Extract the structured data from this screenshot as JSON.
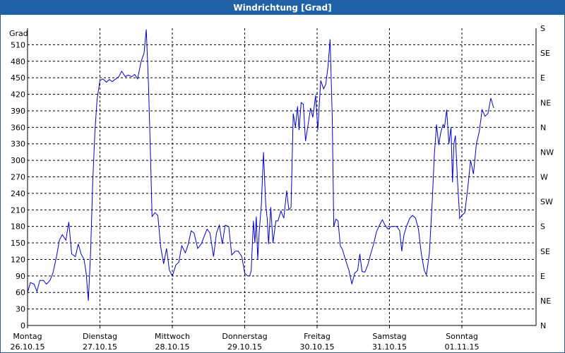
{
  "chart_data": {
    "type": "line",
    "title": "Windrichtung [Grad]",
    "ylabel": "Grad",
    "ylim": [
      0,
      540
    ],
    "yticks": [
      0,
      30,
      60,
      90,
      120,
      150,
      180,
      210,
      240,
      270,
      300,
      330,
      360,
      390,
      420,
      450,
      480,
      510
    ],
    "right_axis_labels": [
      "N",
      "NE",
      "E",
      "SE",
      "S",
      "SW",
      "W",
      "NW",
      "N",
      "NE",
      "E",
      "SE",
      "S"
    ],
    "x_ticks": [
      {
        "day": "Montag",
        "date": "26.10.15"
      },
      {
        "day": "Dienstag",
        "date": "27.10.15"
      },
      {
        "day": "Mittwoch",
        "date": "28.10.15"
      },
      {
        "day": "Donnerstag",
        "date": "29.10.15"
      },
      {
        "day": "Freitag",
        "date": "30.10.15"
      },
      {
        "day": "Samstag",
        "date": "31.10.15"
      },
      {
        "day": "Sonntag",
        "date": "01.11.15"
      }
    ],
    "grid": true,
    "series": [
      {
        "color": "#0000cc",
        "points": [
          [
            0.0,
            60
          ],
          [
            0.04,
            78
          ],
          [
            0.09,
            75
          ],
          [
            0.13,
            62
          ],
          [
            0.17,
            82
          ],
          [
            0.22,
            82
          ],
          [
            0.26,
            75
          ],
          [
            0.31,
            82
          ],
          [
            0.35,
            95
          ],
          [
            0.4,
            125
          ],
          [
            0.44,
            155
          ],
          [
            0.48,
            165
          ],
          [
            0.53,
            155
          ],
          [
            0.57,
            188
          ],
          [
            0.61,
            130
          ],
          [
            0.66,
            125
          ],
          [
            0.7,
            148
          ],
          [
            0.74,
            130
          ],
          [
            0.78,
            120
          ],
          [
            0.81,
            95
          ],
          [
            0.84,
            45
          ],
          [
            0.87,
            130
          ],
          [
            0.9,
            260
          ],
          [
            0.93,
            350
          ],
          [
            0.96,
            410
          ],
          [
            1.0,
            445
          ],
          [
            1.04,
            448
          ],
          [
            1.09,
            442
          ],
          [
            1.13,
            447
          ],
          [
            1.17,
            443
          ],
          [
            1.22,
            448
          ],
          [
            1.26,
            452
          ],
          [
            1.3,
            462
          ],
          [
            1.35,
            452
          ],
          [
            1.39,
            455
          ],
          [
            1.44,
            452
          ],
          [
            1.48,
            456
          ],
          [
            1.52,
            448
          ],
          [
            1.57,
            480
          ],
          [
            1.61,
            495
          ],
          [
            1.64,
            538
          ],
          [
            1.67,
            440
          ],
          [
            1.7,
            300
          ],
          [
            1.72,
            198
          ],
          [
            1.76,
            205
          ],
          [
            1.8,
            200
          ],
          [
            1.84,
            142
          ],
          [
            1.88,
            112
          ],
          [
            1.92,
            140
          ],
          [
            1.96,
            100
          ],
          [
            2.0,
            90
          ],
          [
            2.05,
            110
          ],
          [
            2.09,
            115
          ],
          [
            2.13,
            145
          ],
          [
            2.18,
            132
          ],
          [
            2.22,
            148
          ],
          [
            2.26,
            172
          ],
          [
            2.3,
            168
          ],
          [
            2.35,
            140
          ],
          [
            2.4,
            148
          ],
          [
            2.44,
            162
          ],
          [
            2.48,
            175
          ],
          [
            2.52,
            168
          ],
          [
            2.57,
            125
          ],
          [
            2.61,
            168
          ],
          [
            2.65,
            182
          ],
          [
            2.69,
            148
          ],
          [
            2.73,
            182
          ],
          [
            2.78,
            180
          ],
          [
            2.82,
            128
          ],
          [
            2.87,
            135
          ],
          [
            2.91,
            135
          ],
          [
            2.96,
            125
          ],
          [
            3.0,
            95
          ],
          [
            3.04,
            90
          ],
          [
            3.07,
            90
          ],
          [
            3.09,
            100
          ],
          [
            3.12,
            190
          ],
          [
            3.14,
            150
          ],
          [
            3.16,
            198
          ],
          [
            3.18,
            120
          ],
          [
            3.2,
            170
          ],
          [
            3.23,
            220
          ],
          [
            3.26,
            315
          ],
          [
            3.29,
            220
          ],
          [
            3.31,
            195
          ],
          [
            3.33,
            148
          ],
          [
            3.36,
            215
          ],
          [
            3.39,
            150
          ],
          [
            3.43,
            190
          ],
          [
            3.46,
            190
          ],
          [
            3.5,
            208
          ],
          [
            3.54,
            195
          ],
          [
            3.58,
            245
          ],
          [
            3.61,
            210
          ],
          [
            3.64,
            215
          ],
          [
            3.67,
            385
          ],
          [
            3.7,
            360
          ],
          [
            3.73,
            398
          ],
          [
            3.75,
            355
          ],
          [
            3.78,
            405
          ],
          [
            3.81,
            402
          ],
          [
            3.84,
            335
          ],
          [
            3.87,
            360
          ],
          [
            3.91,
            395
          ],
          [
            3.94,
            378
          ],
          [
            3.98,
            418
          ],
          [
            4.01,
            355
          ],
          [
            4.05,
            445
          ],
          [
            4.09,
            430
          ],
          [
            4.12,
            438
          ],
          [
            4.15,
            470
          ],
          [
            4.18,
            520
          ],
          [
            4.21,
            375
          ],
          [
            4.23,
            180
          ],
          [
            4.26,
            193
          ],
          [
            4.29,
            190
          ],
          [
            4.32,
            145
          ],
          [
            4.35,
            138
          ],
          [
            4.39,
            120
          ],
          [
            4.44,
            100
          ],
          [
            4.48,
            75
          ],
          [
            4.52,
            95
          ],
          [
            4.56,
            100
          ],
          [
            4.59,
            130
          ],
          [
            4.62,
            98
          ],
          [
            4.66,
            97
          ],
          [
            4.7,
            110
          ],
          [
            4.74,
            130
          ],
          [
            4.78,
            148
          ],
          [
            4.82,
            170
          ],
          [
            4.86,
            182
          ],
          [
            4.9,
            192
          ],
          [
            4.94,
            182
          ],
          [
            4.98,
            175
          ],
          [
            5.02,
            180
          ],
          [
            5.06,
            180
          ],
          [
            5.1,
            180
          ],
          [
            5.14,
            172
          ],
          [
            5.17,
            135
          ],
          [
            5.2,
            165
          ],
          [
            5.24,
            182
          ],
          [
            5.28,
            195
          ],
          [
            5.32,
            200
          ],
          [
            5.36,
            195
          ],
          [
            5.4,
            175
          ],
          [
            5.44,
            130
          ],
          [
            5.48,
            100
          ],
          [
            5.51,
            92
          ],
          [
            5.55,
            130
          ],
          [
            5.59,
            225
          ],
          [
            5.62,
            310
          ],
          [
            5.65,
            365
          ],
          [
            5.68,
            328
          ],
          [
            5.71,
            352
          ],
          [
            5.74,
            365
          ],
          [
            5.76,
            360
          ],
          [
            5.79,
            392
          ],
          [
            5.82,
            330
          ],
          [
            5.85,
            360
          ],
          [
            5.87,
            260
          ],
          [
            5.89,
            330
          ],
          [
            5.91,
            345
          ],
          [
            5.94,
            260
          ],
          [
            5.97,
            195
          ],
          [
            6.0,
            200
          ],
          [
            6.04,
            205
          ],
          [
            6.08,
            248
          ],
          [
            6.12,
            300
          ],
          [
            6.16,
            275
          ],
          [
            6.2,
            330
          ],
          [
            6.24,
            352
          ],
          [
            6.28,
            392
          ],
          [
            6.32,
            380
          ],
          [
            6.36,
            385
          ],
          [
            6.4,
            413
          ],
          [
            6.44,
            395
          ]
        ]
      }
    ]
  }
}
